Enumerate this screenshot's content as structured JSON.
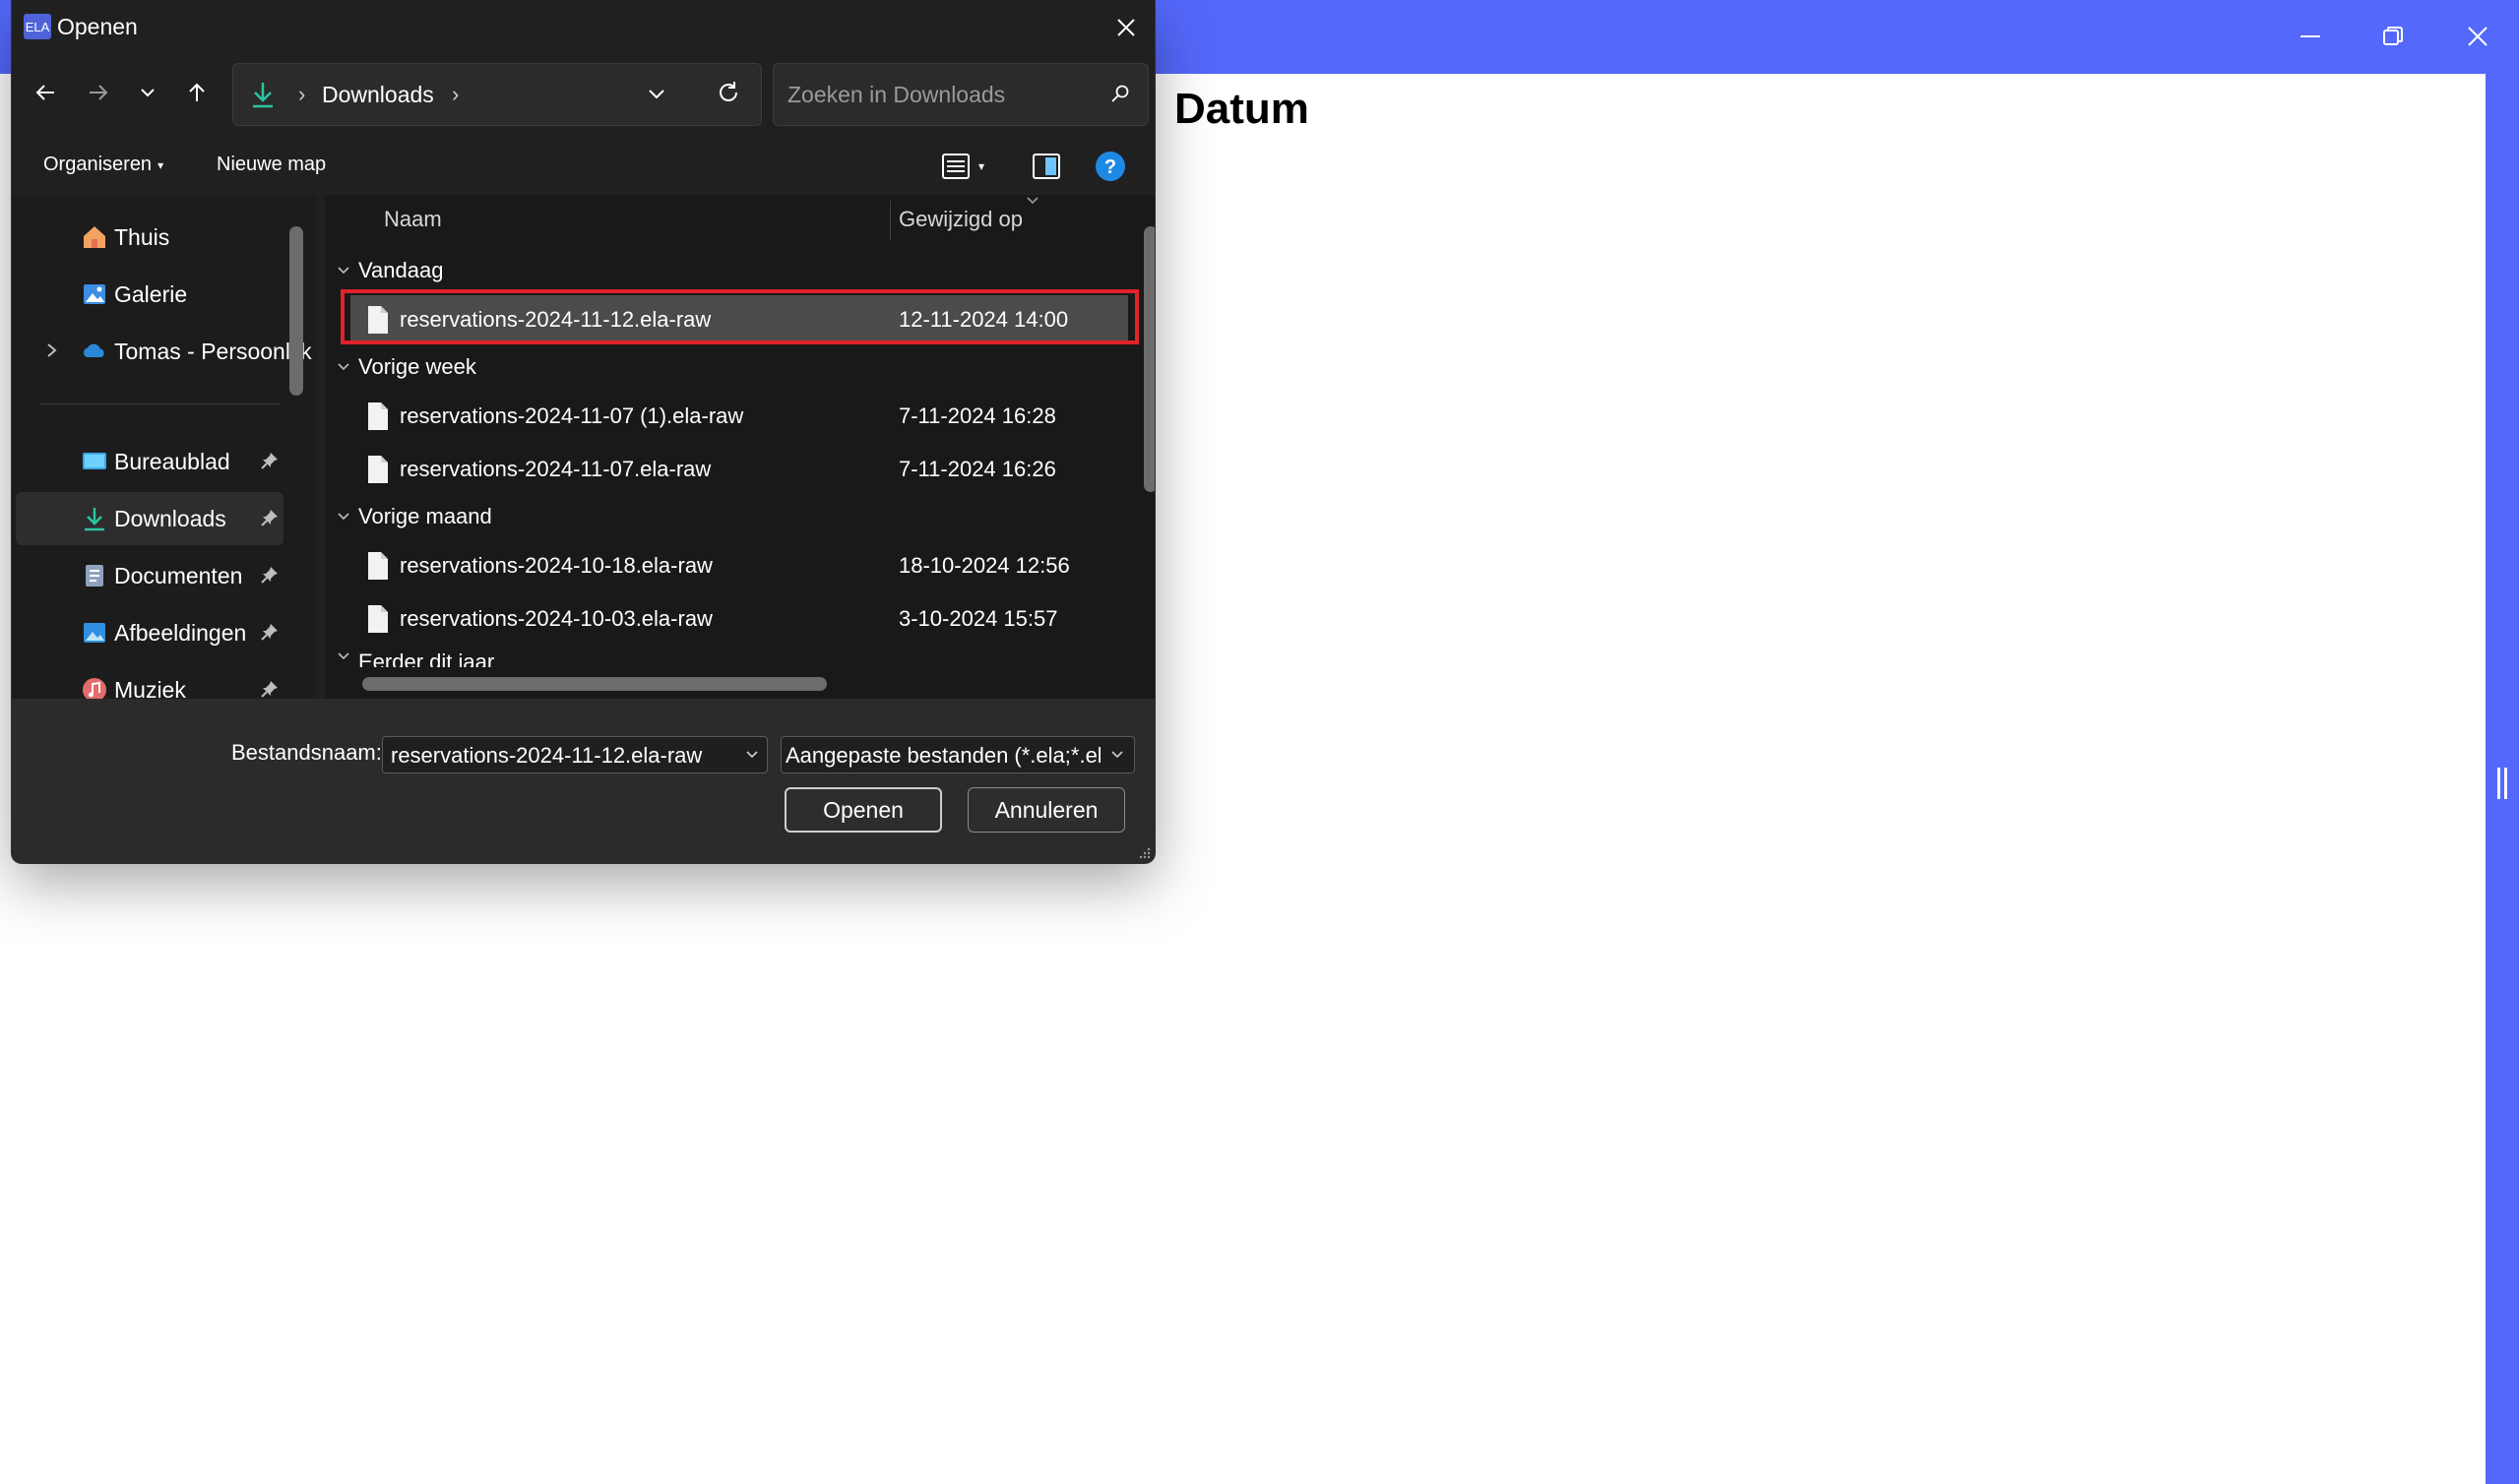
{
  "app": {
    "heading": "Datum",
    "accent_color": "#5468fb",
    "window_controls": [
      "minimize-icon",
      "restore-icon",
      "close-icon"
    ]
  },
  "dialog": {
    "app_icon_text": "ELA",
    "title": "Openen",
    "address": {
      "current_folder": "Downloads",
      "icon": "download-icon"
    },
    "search": {
      "placeholder": "Zoeken in Downloads"
    },
    "commands": {
      "organize": "Organiseren",
      "new_folder": "Nieuwe map"
    },
    "sidebar": {
      "items": [
        {
          "label": "Thuis",
          "icon": "home-icon",
          "pinned": false
        },
        {
          "label": "Galerie",
          "icon": "gallery-icon",
          "pinned": false
        },
        {
          "label": "Tomas - Persoonlijk",
          "icon": "onedrive-icon",
          "pinned": false,
          "expandable": true
        },
        {
          "label": "Bureaublad",
          "icon": "desktop-icon",
          "pinned": true
        },
        {
          "label": "Downloads",
          "icon": "download-icon",
          "pinned": true,
          "selected": true
        },
        {
          "label": "Documenten",
          "icon": "documents-icon",
          "pinned": true
        },
        {
          "label": "Afbeeldingen",
          "icon": "pictures-icon",
          "pinned": true
        },
        {
          "label": "Muziek",
          "icon": "music-icon",
          "pinned": true
        }
      ]
    },
    "columns": {
      "name": "Naam",
      "modified": "Gewijzigd op"
    },
    "groups": [
      {
        "label": "Vandaag",
        "files": [
          {
            "name": "reservations-2024-11-12.ela-raw",
            "modified": "12-11-2024 14:00",
            "selected": true
          }
        ]
      },
      {
        "label": "Vorige week",
        "files": [
          {
            "name": "reservations-2024-11-07 (1).ela-raw",
            "modified": "7-11-2024 16:28"
          },
          {
            "name": "reservations-2024-11-07.ela-raw",
            "modified": "7-11-2024 16:26"
          }
        ]
      },
      {
        "label": "Vorige maand",
        "files": [
          {
            "name": "reservations-2024-10-18.ela-raw",
            "modified": "18-10-2024 12:56"
          },
          {
            "name": "reservations-2024-10-03.ela-raw",
            "modified": "3-10-2024 15:57"
          }
        ]
      },
      {
        "label": "Eerder dit jaar",
        "files": []
      }
    ],
    "footer": {
      "filename_label": "Bestandsnaam:",
      "filename_value": "reservations-2024-11-12.ela-raw",
      "filetype_value": "Aangepaste bestanden (*.ela;*.ela-raw)",
      "open_label": "Openen",
      "cancel_label": "Annuleren"
    }
  }
}
